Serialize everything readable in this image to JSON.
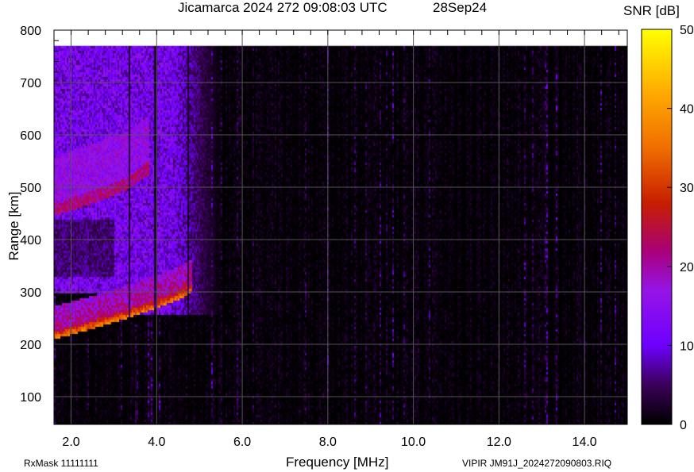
{
  "header": {
    "title": "Jicamarca 2024 272 09:08:03 UTC",
    "date": "28Sep24",
    "colorbar_title": "SNR [dB]"
  },
  "footer": {
    "rxmask": "RxMask 11111111",
    "file": "VIPIR  JM91J_2024272090803.RIQ"
  },
  "chart_data": {
    "type": "heatmap",
    "title": "Jicamarca 2024 272 09:08:03 UTC",
    "xlabel": "Frequency [MHz]",
    "ylabel": "Range [km]",
    "xlim": [
      1.6,
      15.0
    ],
    "ylim": [
      47,
      800
    ],
    "xticks": [
      2,
      4,
      6,
      8,
      10,
      12,
      14
    ],
    "xtick_labels": [
      "2.0",
      "4.0",
      "6.0",
      "8.0",
      "10.0",
      "12.0",
      "14.0"
    ],
    "yticks": [
      100,
      200,
      300,
      400,
      500,
      600,
      700,
      800
    ],
    "ytick_labels": [
      "100",
      "200",
      "300",
      "400",
      "500",
      "600",
      "700",
      "800"
    ],
    "data_top_km": 770,
    "colorbar": {
      "label": "SNR [dB]",
      "range": [
        0,
        50
      ],
      "ticks": [
        0,
        10,
        20,
        30,
        40,
        50
      ],
      "tick_labels": [
        "0",
        "10",
        "20",
        "30",
        "40",
        "50"
      ]
    },
    "traces": [
      {
        "name": "F-layer echo",
        "points": [
          [
            1.6,
            215
          ],
          [
            2.5,
            235
          ],
          [
            3.3,
            255
          ],
          [
            4.0,
            275
          ],
          [
            4.5,
            290
          ],
          [
            4.8,
            305
          ]
        ],
        "snr": 35
      },
      {
        "name": "second-hop echo",
        "points": [
          [
            1.6,
            450
          ],
          [
            2.5,
            475
          ],
          [
            3.3,
            500
          ],
          [
            3.8,
            530
          ]
        ],
        "snr": 22
      },
      {
        "name": "spread F",
        "freq_range": [
          1.6,
          5.5
        ],
        "range_km": [
          260,
          770
        ],
        "snr": 14
      }
    ],
    "grid": true
  }
}
